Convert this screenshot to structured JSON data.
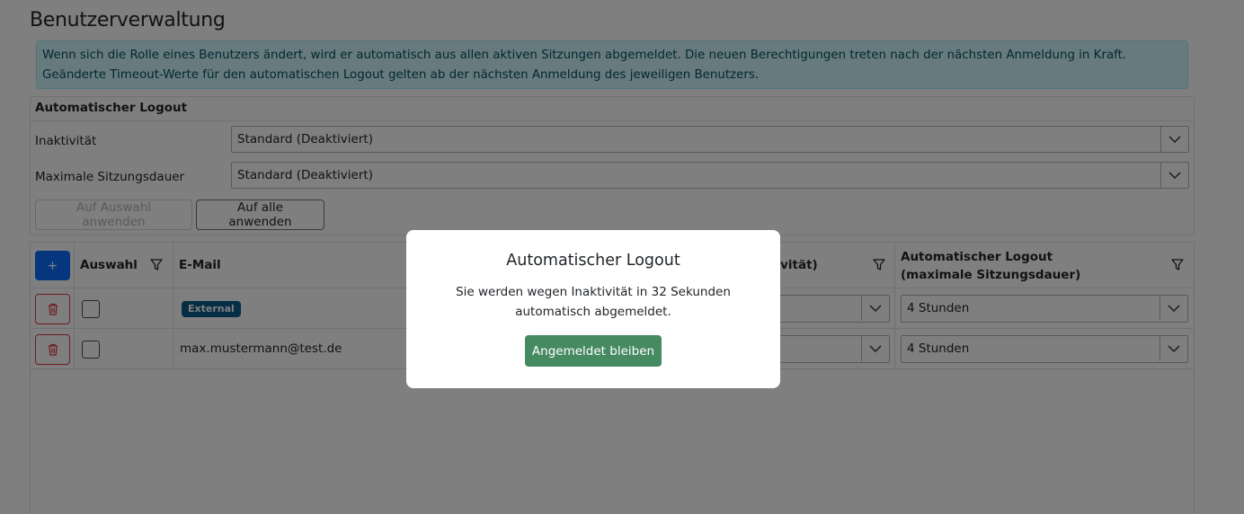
{
  "page": {
    "title": "Benutzerverwaltung",
    "info_text": "Wenn sich die Rolle eines Benutzers ändert, wird er automatisch aus allen aktiven Sitzungen abgemeldet. Die neuen Berechtigungen treten nach der nächsten Anmeldung in Kraft. Geänderte Timeout-Werte für den automatischen Logout gelten ab der nächsten Anmeldung des jeweiligen Benutzers."
  },
  "logout_panel": {
    "title": "Automatischer Logout",
    "inactivity_label": "Inaktivität",
    "inactivity_value": "Standard (Deaktiviert)",
    "max_session_label": "Maximale Sitzungsdauer",
    "max_session_value": "Standard (Deaktiviert)",
    "apply_selection_label": "Auf Auswahl anwenden",
    "apply_all_label": "Auf alle anwenden"
  },
  "grid": {
    "add_label": "+",
    "columns": {
      "selection": "Auswahl",
      "email": "E-Mail",
      "inactivity": "tivität)",
      "max_session": "Automatischer Logout (maximale Sitzungsdauer)"
    },
    "rows": [
      {
        "badge": "External",
        "email": "",
        "max_session": "4 Stunden"
      },
      {
        "badge": "",
        "email": "max.mustermann@test.de",
        "max_session": "4 Stunden"
      }
    ]
  },
  "modal": {
    "title": "Automatischer Logout",
    "message": "Sie werden wegen Inaktivität in 32 Sekunden automatisch abgemeldet.",
    "button_label": "Angemeldet bleiben"
  },
  "colors": {
    "primary": "#0d6efd",
    "danger": "#dc3545",
    "success_button": "#468a62",
    "info_bg": "#cff4fc",
    "badge": "#0d5c8a"
  }
}
